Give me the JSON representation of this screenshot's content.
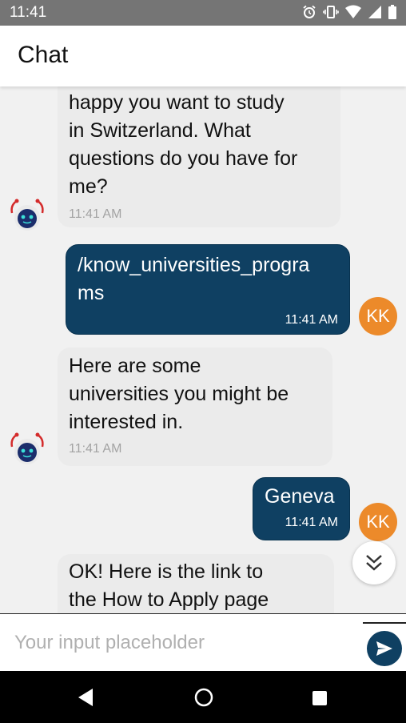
{
  "status_bar": {
    "time": "11:41",
    "icons": [
      "alarm-icon",
      "vibrate-icon",
      "wifi-icon",
      "signal-icon",
      "battery-icon"
    ]
  },
  "app_bar": {
    "title": "Chat"
  },
  "messages": [
    {
      "sender": "bot",
      "text": "happy you want to study\nin Switzerland.  What\nquestions do you have for\nme?",
      "time": "11:41 AM"
    },
    {
      "sender": "user",
      "text": "/know_universities_progra\nms",
      "time": "11:41 AM",
      "initials": "KK"
    },
    {
      "sender": "bot",
      "text": "Here are some\nuniversities you might be\ninterested in.",
      "time": "11:41 AM"
    },
    {
      "sender": "user",
      "text": "Geneva",
      "time": "11:41 AM",
      "initials": "KK"
    },
    {
      "sender": "bot",
      "text": "OK! Here is the link to\nthe How to Apply page"
    }
  ],
  "input": {
    "placeholder": "Your input placeholder",
    "value": ""
  },
  "colors": {
    "user_bubble": "#0f4062",
    "bot_bubble": "#ebebeb",
    "user_avatar": "#ec8a2a",
    "chat_background": "#f1f1f1"
  }
}
